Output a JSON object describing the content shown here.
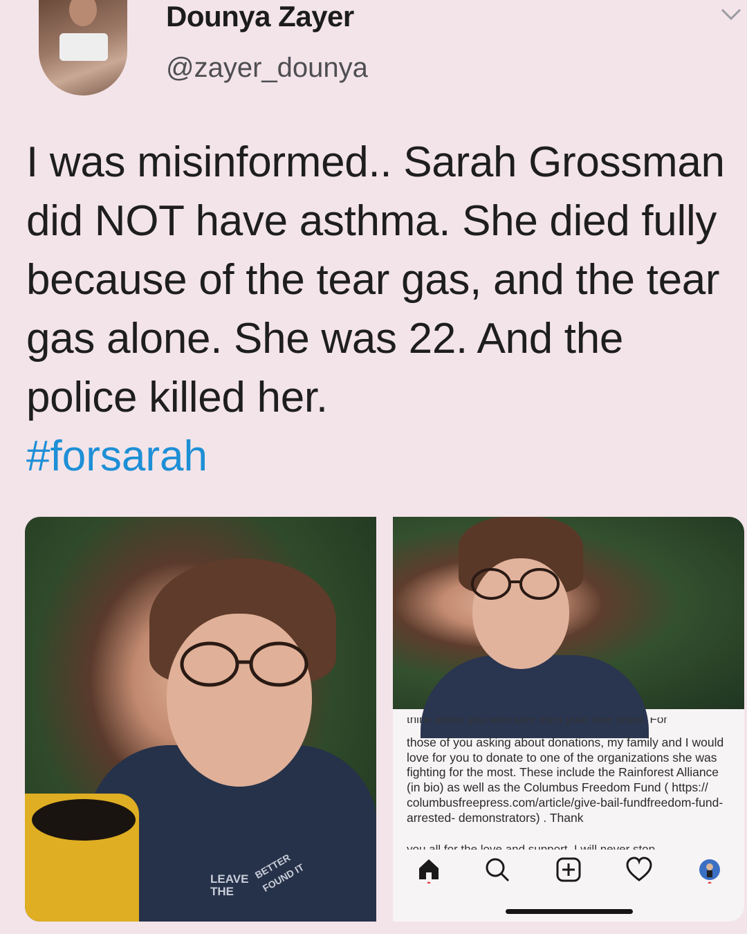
{
  "tweet": {
    "author": {
      "display_name": "Dounya Zayer",
      "handle": "@zayer_dounya"
    },
    "text": "I was misinformed.. Sarah Grossman did NOT have asthma. She died fully because of the tear gas, and the tear gas alone.  She was 22. And the police killed her.",
    "hashtag": "#forsarah"
  },
  "embedded_post": {
    "caption_top_cut": "think about you with love from your little sister. For",
    "caption": "those of you asking about donations, my family and I would love for you to donate to one of the organizations she was fighting for the most. These include the Rainforest Alliance (in bio) as well as the Columbus Freedom Fund ( https:// columbusfreepress.com/article/give-bail-fundfreedom-fund-arrested- demonstrators) . Thank",
    "caption_bottom_cut": "you all for the love and support. I will never stop"
  },
  "photo_shirt_text": {
    "line1": "LEAVE",
    "line2": "THE",
    "line3": "BETTER",
    "line4": "FOUND IT"
  },
  "colors": {
    "background": "#f3e4e9",
    "hashtag": "#1d8fd6",
    "text": "#1e1e1e"
  }
}
